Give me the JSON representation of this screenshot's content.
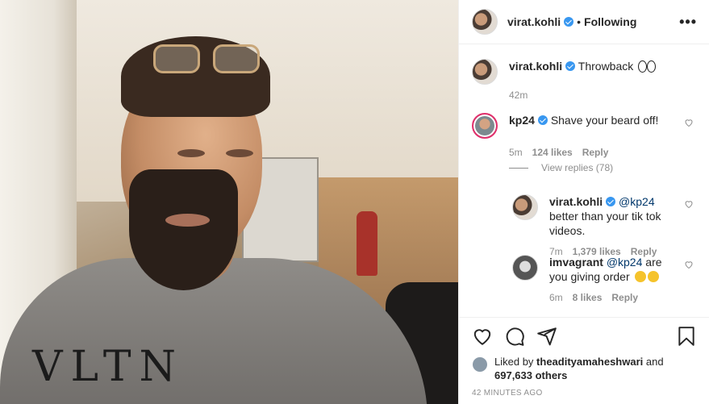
{
  "header": {
    "username": "virat.kohli",
    "separator": "•",
    "follow_status": "Following",
    "more": "•••"
  },
  "photo": {
    "sweater_print": "VLTN"
  },
  "caption": {
    "username": "virat.kohli",
    "text": "Throwback",
    "time": "42m"
  },
  "comments": [
    {
      "username": "kp24",
      "text": "Shave your beard off!",
      "time": "5m",
      "likes": "124 likes",
      "reply": "Reply"
    }
  ],
  "view_replies": "View replies (78)",
  "replies": [
    {
      "username": "virat.kohli",
      "mention": "@kp24",
      "text": " better than your tik tok videos.",
      "time": "7m",
      "likes": "1,379 likes",
      "reply": "Reply"
    },
    {
      "username": "imvagrant",
      "mention": "@kp24",
      "text": " are you giving order",
      "time": "6m",
      "likes": "8 likes",
      "reply": "Reply"
    }
  ],
  "likes": {
    "prefix": "Liked by",
    "user": "theadityamaheshwari",
    "and": "and",
    "others": "697,633 others"
  },
  "timestamp": "42 MINUTES AGO",
  "icons": {
    "like": "heart-icon",
    "comment": "comment-icon",
    "share": "share-icon",
    "save": "bookmark-icon",
    "verified": "verified-badge-icon"
  },
  "colors": {
    "verified": "#3897f0",
    "mention": "#00376b",
    "muted": "#8e8e8e"
  }
}
